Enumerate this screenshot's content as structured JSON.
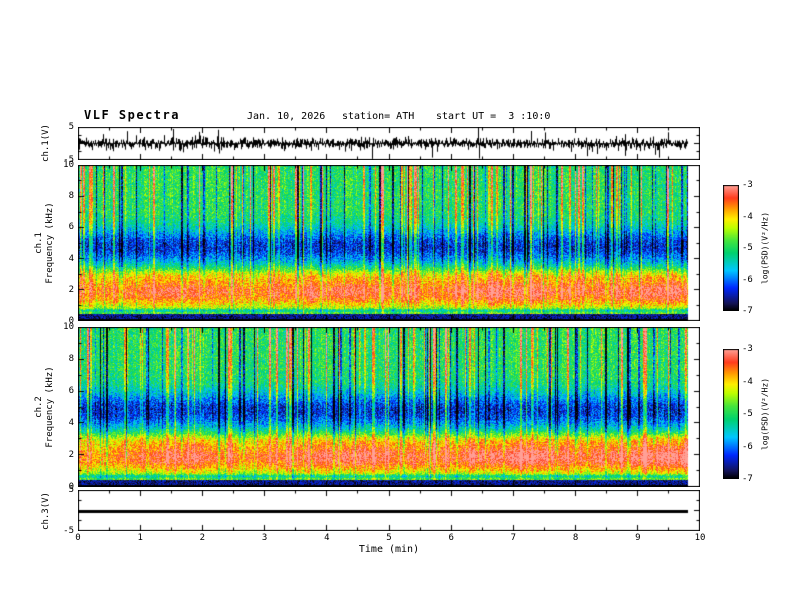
{
  "header": {
    "title": "VLF Spectra",
    "date": "Jan. 10, 2026",
    "station": "station= ATH",
    "start_ut": "start UT =  3 :10:0"
  },
  "time_axis": {
    "label": "Time (min)",
    "tick_labels": [
      "0",
      "1",
      "2",
      "3",
      "4",
      "5",
      "6",
      "7",
      "8",
      "9",
      "10"
    ],
    "min": 0,
    "max": 10,
    "data_end_min": 9.8
  },
  "panels": {
    "ch1_wave": {
      "ylabel": "ch.1(V)",
      "ytick_labels": [
        "5",
        "-5"
      ],
      "ymin": -5,
      "ymax": 5
    },
    "spec1": {
      "ylabel_line1": "ch.1",
      "ylabel_line2": "Frequency (kHz)",
      "ytick_labels": [
        "10",
        "8",
        "6",
        "4",
        "2",
        "0"
      ],
      "ymin": 0,
      "ymax": 10
    },
    "spec2": {
      "ylabel_line1": "ch.2",
      "ylabel_line2": "Frequency (kHz)",
      "ytick_labels": [
        "10",
        "8",
        "6",
        "4",
        "2",
        "0"
      ],
      "ymin": 0,
      "ymax": 10
    },
    "ch3_wave": {
      "ylabel": "ch.3(V)",
      "ytick_labels": [
        "5",
        "-5"
      ],
      "ymin": -5,
      "ymax": 5
    }
  },
  "colorbar": {
    "label": "log(PSD)(V²/Hz)",
    "tick_labels": [
      "-3",
      "-4",
      "-5",
      "-6",
      "-7"
    ],
    "min": -7,
    "max": -3,
    "stops": [
      [
        0.0,
        "#000000"
      ],
      [
        0.06,
        "#14145a"
      ],
      [
        0.18,
        "#0028ff"
      ],
      [
        0.32,
        "#00c8ff"
      ],
      [
        0.46,
        "#00d26e"
      ],
      [
        0.56,
        "#46e63c"
      ],
      [
        0.66,
        "#beff00"
      ],
      [
        0.73,
        "#fff000"
      ],
      [
        0.81,
        "#ffa000"
      ],
      [
        0.9,
        "#ff3c1e"
      ],
      [
        1.0,
        "#ffa096"
      ]
    ]
  },
  "colors": {
    "background": "#ffffff",
    "frame": "#000000",
    "trace": "#000000"
  },
  "chart_data": [
    {
      "type": "line",
      "name": "ch1-time-series",
      "xlabel": "Time (min)",
      "ylabel": "ch.1(V)",
      "xlim": [
        0,
        10
      ],
      "ylim": [
        -5,
        5
      ],
      "summary": "Dense broadband VLF waveform: zero-mean noise, rms ≈ 1 V, frequent impulsive sferic spikes reaching ±4–5 V, statistically uniform over 0–9.8 min; no data after 9.8 min"
    },
    {
      "type": "heatmap",
      "name": "ch1-spectrogram",
      "xlabel": "Time (min)",
      "ylabel": "ch.1 Frequency (kHz)",
      "xlim": [
        0,
        10
      ],
      "ylim": [
        0,
        10
      ],
      "zlabel": "log(PSD)(V²/Hz)",
      "zlim": [
        -7,
        -3
      ],
      "features": {
        "background_psd": -5.0,
        "strong_band": {
          "freq_khz": [
            1.2,
            2.7
          ],
          "peak_khz": 1.9,
          "psd": -3.5,
          "trend": "red band, intensifies slightly with time"
        },
        "narrow_line": {
          "freq_khz": 3.0,
          "psd": -4.5
        },
        "quiet_band": {
          "freq_khz": [
            4.0,
            5.6
          ],
          "psd": -6.3,
          "note": "dark blue band"
        },
        "low_freq_cutoff": {
          "freq_khz": [
            0,
            0.4
          ],
          "psd": -7.0,
          "note": "black/dark band along bottom edge"
        },
        "sferics": "dense vertical striations every few seconds spanning 0–10 kHz, strongest above 5 kHz, alternating high (red/green) and low (dark blue) PSD columns"
      }
    },
    {
      "type": "heatmap",
      "name": "ch2-spectrogram",
      "xlabel": "Time (min)",
      "ylabel": "ch.2 Frequency (kHz)",
      "xlim": [
        0,
        10
      ],
      "ylim": [
        0,
        10
      ],
      "zlabel": "log(PSD)(V²/Hz)",
      "zlim": [
        -7,
        -3
      ],
      "features": {
        "background_psd": -5.0,
        "strong_band": {
          "freq_khz": [
            1.2,
            2.8
          ],
          "peak_khz": 2.0,
          "psd": -3.4,
          "trend": "red band broadens and strengthens after ~4 min"
        },
        "narrow_line": {
          "freq_khz": 3.0,
          "psd": -4.5
        },
        "quiet_band": {
          "freq_khz": [
            4.0,
            5.6
          ],
          "psd": -6.3
        },
        "low_freq_cutoff": {
          "freq_khz": [
            0,
            0.4
          ],
          "psd": -7.0
        },
        "sferics": "dense vertical striations identical in character to ch.1 panel"
      }
    },
    {
      "type": "line",
      "name": "ch3-time-series",
      "xlabel": "Time (min)",
      "ylabel": "ch.3(V)",
      "xlim": [
        0,
        10
      ],
      "ylim": [
        -5,
        5
      ],
      "values_constant": 0,
      "summary": "Constant 0 V thick flat black line (inactive channel) over 0–9.8 min"
    }
  ]
}
